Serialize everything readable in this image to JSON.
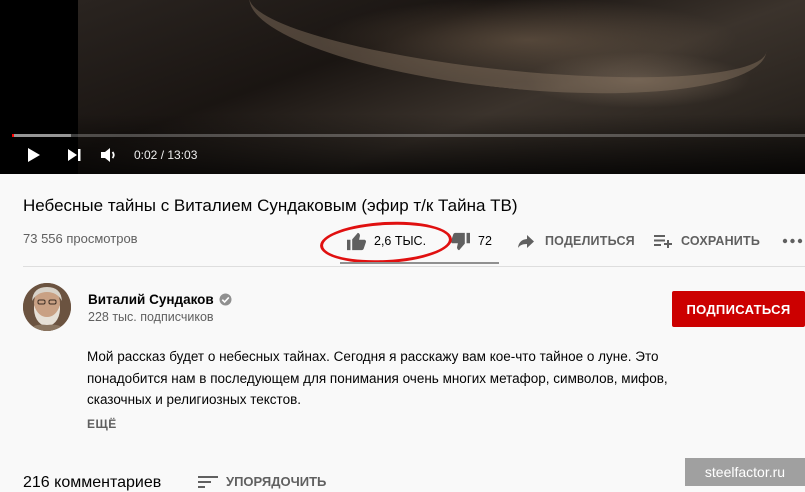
{
  "player": {
    "time": "0:02 / 13:03",
    "progress_played": 0.0026,
    "progress_loaded": 0.075
  },
  "video": {
    "title": "Небесные тайны с Виталием Сундаковым (эфир т/к Тайна ТВ)",
    "views": "73 556 просмотров"
  },
  "actions": {
    "likes": "2,6 ТЫС.",
    "dislikes": "72",
    "share": "ПОДЕЛИТЬСЯ",
    "save": "СОХРАНИТЬ",
    "more": "..."
  },
  "channel": {
    "name": "Виталий Сундаков",
    "subscribers": "228 тыс. подписчиков",
    "subscribe_label": "ПОДПИСАТЬСЯ"
  },
  "description": {
    "line1": "Мой рассказ будет о небесных тайнах. Сегодня я расскажу вам кое-что тайное о луне. Это",
    "line2": "понадобится нам в последующем для понимания очень многих метафор, символов, мифов,",
    "line3": "сказочных и религиозных текстов.",
    "more_label": "ЕЩЁ"
  },
  "comments": {
    "count": "216 комментариев",
    "sort_label": "УПОРЯДОЧИТЬ"
  },
  "watermark": "steelfactor.ru",
  "colors": {
    "subscribe": "#cc0000",
    "annotation": "#e01010",
    "progress": "#ff0000"
  }
}
